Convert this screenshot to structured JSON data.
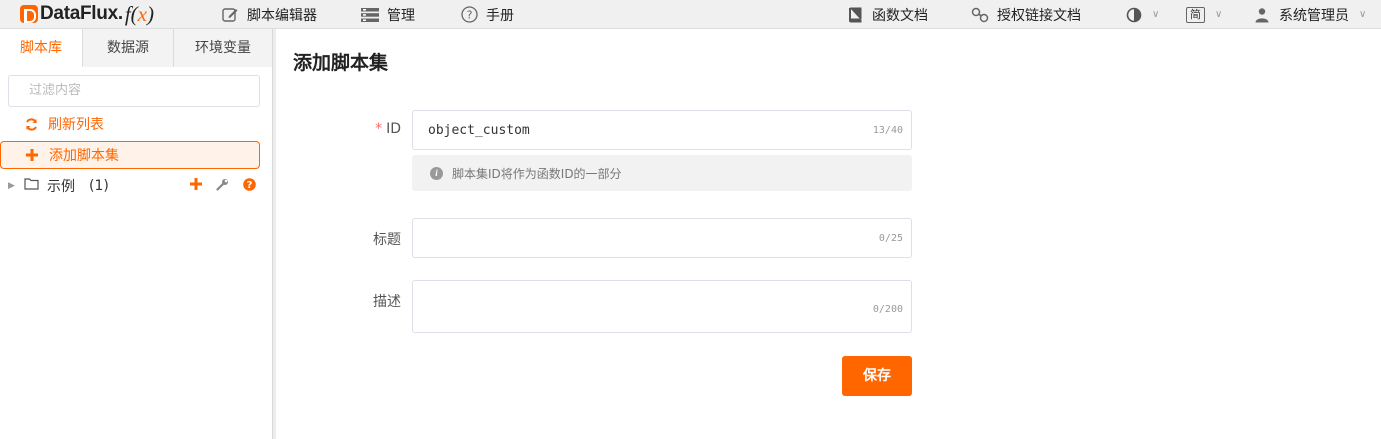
{
  "brand": {
    "name": "DataFlux.",
    "fx": "f(",
    "x": "x",
    "fx_close": ")"
  },
  "topnav": {
    "script_editor": "脚本编辑器",
    "manage": "管理",
    "manual": "手册",
    "func_docs": "函数文档",
    "auth_link_docs": "授权链接文档",
    "lang": "简",
    "user": "系统管理员"
  },
  "sidebar": {
    "tabs": [
      "脚本库",
      "数据源",
      "环境变量"
    ],
    "filter_placeholder": "过滤内容",
    "refresh": "刷新列表",
    "add_set": "添加脚本集",
    "tree_item": {
      "label": "示例",
      "count": "(1)"
    }
  },
  "main": {
    "title": "添加脚本集",
    "id": {
      "label": "ID",
      "value": "object_custom",
      "counter": "13/40",
      "hint": "脚本集ID将作为函数ID的一部分"
    },
    "title_field": {
      "label": "标题",
      "value": "",
      "counter": "0/25"
    },
    "desc_field": {
      "label": "描述",
      "value": "",
      "counter": "0/200"
    },
    "save": "保存"
  },
  "colors": {
    "accent": "#ff6600",
    "required": "#f56c6c"
  },
  "icons": [
    "edit-icon",
    "manage-icon",
    "help-icon",
    "book-icon",
    "link-icon",
    "contrast-icon",
    "user-icon",
    "refresh-icon",
    "plus-icon",
    "folder-icon",
    "wrench-icon",
    "question-icon",
    "info-icon"
  ]
}
